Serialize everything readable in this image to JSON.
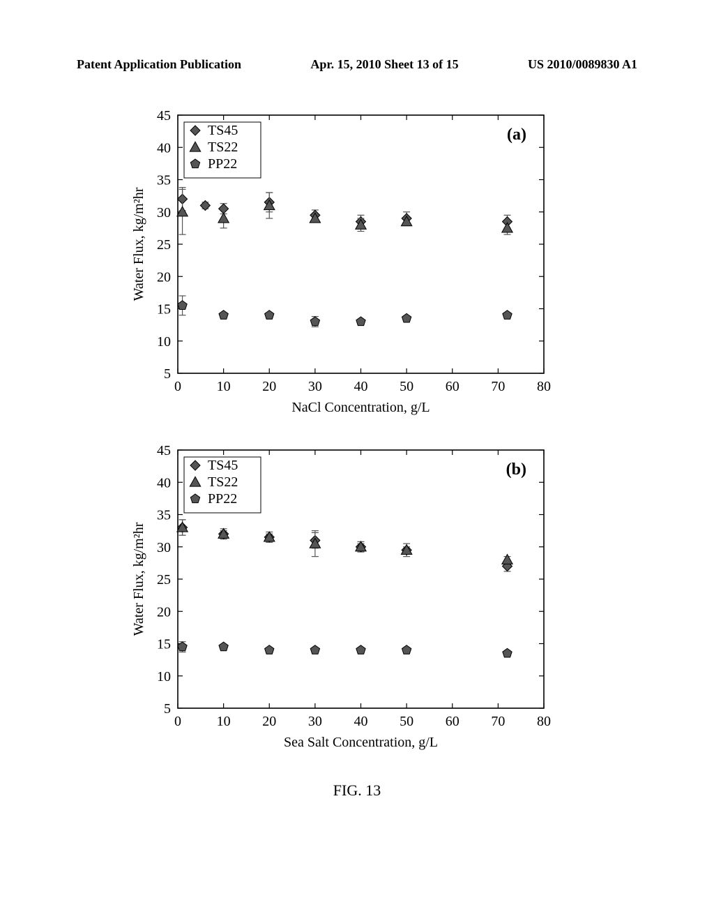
{
  "header": {
    "left": "Patent Application Publication",
    "mid": "Apr. 15, 2010  Sheet 13 of 15",
    "right": "US 2010/0089830 A1"
  },
  "figure_label": "FIG. 13",
  "chart_data": [
    {
      "type": "scatter",
      "panel_label": "(a)",
      "title": "",
      "xlabel": "NaCl Concentration, g/L",
      "ylabel": "Water Flux, kg/m²hr",
      "xlim": [
        0,
        80
      ],
      "ylim": [
        5,
        45
      ],
      "xticks": [
        0,
        10,
        20,
        30,
        40,
        50,
        60,
        70,
        80
      ],
      "yticks": [
        5,
        10,
        15,
        20,
        25,
        30,
        35,
        40,
        45
      ],
      "legend": [
        "TS45",
        "TS22",
        "PP22"
      ],
      "series": [
        {
          "name": "TS45",
          "marker": "diamond",
          "x": [
            1,
            6,
            10,
            20,
            30,
            40,
            50,
            72
          ],
          "y": [
            32,
            31,
            30.5,
            31.5,
            29.5,
            28.5,
            29,
            28.5
          ],
          "err": [
            1.8,
            0.5,
            0.8,
            1.5,
            0.8,
            1.0,
            1.0,
            1.0
          ]
        },
        {
          "name": "TS22",
          "marker": "triangle",
          "x": [
            1,
            10,
            20,
            30,
            40,
            50,
            72
          ],
          "y": [
            30,
            29,
            31,
            29,
            28,
            28.5,
            27.5
          ],
          "err": [
            3.5,
            1.5,
            2.0,
            0.5,
            1.0,
            0.5,
            1.0
          ]
        },
        {
          "name": "PP22",
          "marker": "pentagon",
          "x": [
            1,
            10,
            20,
            30,
            40,
            50,
            72
          ],
          "y": [
            15.5,
            14,
            14,
            13,
            13,
            13.5,
            14
          ],
          "err": [
            1.5,
            0.3,
            0.3,
            0.8,
            0.3,
            0.3,
            0.3
          ]
        }
      ]
    },
    {
      "type": "scatter",
      "panel_label": "(b)",
      "title": "",
      "xlabel": "Sea Salt Concentration, g/L",
      "ylabel": "Water Flux, kg/m²hr",
      "xlim": [
        0,
        80
      ],
      "ylim": [
        5,
        45
      ],
      "xticks": [
        0,
        10,
        20,
        30,
        40,
        50,
        60,
        70,
        80
      ],
      "yticks": [
        5,
        10,
        15,
        20,
        25,
        30,
        35,
        40,
        45
      ],
      "legend": [
        "TS45",
        "TS22",
        "PP22"
      ],
      "series": [
        {
          "name": "TS45",
          "marker": "diamond",
          "x": [
            1,
            10,
            20,
            30,
            40,
            50,
            72
          ],
          "y": [
            33,
            32,
            31.5,
            31,
            30,
            29.5,
            27
          ],
          "err": [
            1.2,
            0.8,
            0.8,
            1.2,
            0.8,
            1.0,
            0.8
          ]
        },
        {
          "name": "TS22",
          "marker": "triangle",
          "x": [
            1,
            10,
            20,
            30,
            40,
            50,
            72
          ],
          "y": [
            33,
            32,
            31.5,
            30.5,
            30,
            29.5,
            28
          ],
          "err": [
            1.2,
            0.5,
            0.5,
            2.0,
            0.5,
            0.5,
            0.5
          ]
        },
        {
          "name": "PP22",
          "marker": "pentagon",
          "x": [
            1,
            10,
            20,
            30,
            40,
            50,
            72
          ],
          "y": [
            14.5,
            14.5,
            14,
            14,
            14,
            14,
            13.5
          ],
          "err": [
            0.8,
            0.3,
            0.3,
            0.3,
            0.3,
            0.3,
            0.3
          ]
        }
      ]
    }
  ]
}
